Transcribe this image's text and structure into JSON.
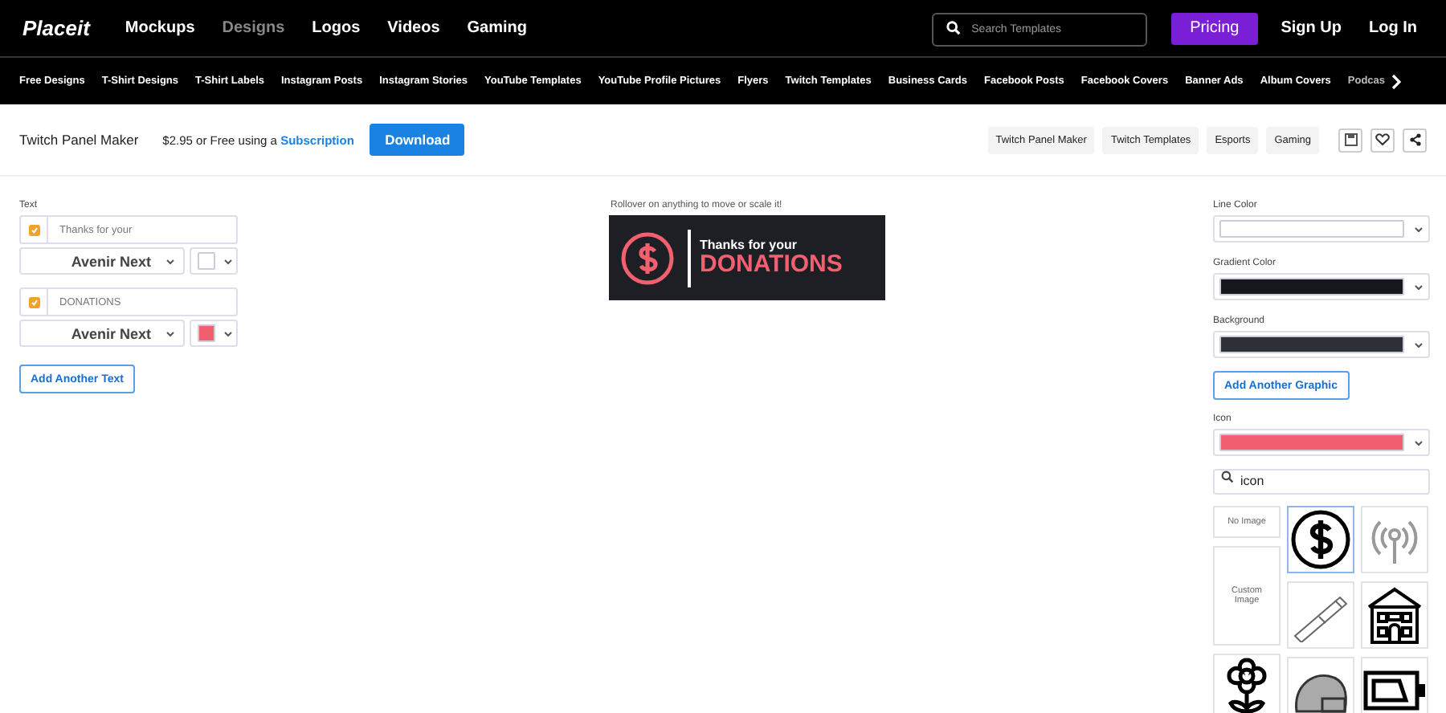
{
  "header": {
    "logo": "Placeit",
    "nav": [
      {
        "label": "Mockups",
        "selected": false
      },
      {
        "label": "Designs",
        "selected": true
      },
      {
        "label": "Logos",
        "selected": false
      },
      {
        "label": "Videos",
        "selected": false
      },
      {
        "label": "Gaming",
        "selected": false
      }
    ],
    "search": {
      "placeholder": "Search Templates"
    },
    "pricing": "Pricing",
    "sign_up": "Sign Up",
    "log_in": "Log In"
  },
  "categories": [
    "Free Designs",
    "T-Shirt Designs",
    "T-Shirt Labels",
    "Instagram Posts",
    "Instagram Stories",
    "YouTube Templates",
    "YouTube Profile Pictures",
    "Flyers",
    "Twitch Templates",
    "Business Cards",
    "Facebook Posts",
    "Facebook Covers",
    "Banner Ads",
    "Album Covers",
    "Podcas"
  ],
  "toolbar": {
    "title": "Twitch Panel Maker",
    "price": "$2.95 or Free using a",
    "link": "Subscription",
    "download": "Download",
    "tags": [
      "Twitch Panel Maker",
      "Twitch Templates",
      "Esports",
      "Gaming"
    ]
  },
  "text_panel": {
    "label": "Text",
    "items": [
      {
        "checked": true,
        "value": "Thanks for your",
        "font": "Avenir Next",
        "color": "#ffffff"
      },
      {
        "checked": true,
        "value": "DONATIONS",
        "font": "Avenir Next",
        "color": "#f0606e"
      }
    ],
    "add_button": "Add Another Text"
  },
  "preview": {
    "hint": "Rollover on anything to move or scale it!",
    "line_1": "Thanks for your",
    "line_2": "DONATIONS"
  },
  "graphic_panel": {
    "fields": [
      {
        "label": "Line Color",
        "color": "#ffffff"
      },
      {
        "label": "Gradient Color",
        "color": "#15171c"
      },
      {
        "label": "Background",
        "color": "#2e3038"
      }
    ],
    "add_button": "Add Another Graphic",
    "icon_field": {
      "label": "Icon",
      "color": "#f0606e"
    },
    "search": {
      "value": "icon"
    },
    "tile_columns": [
      [
        {
          "kind": "text",
          "label": "No Image",
          "selected": false
        },
        {
          "kind": "tall",
          "label": "Custom Image",
          "selected": false
        },
        {
          "kind": "icon",
          "selected": false
        }
      ],
      [
        {
          "kind": "icon",
          "selected": true
        },
        {
          "kind": "icon",
          "selected": false
        },
        {
          "kind": "icon",
          "selected": false
        }
      ],
      [
        {
          "kind": "icon",
          "selected": false
        },
        {
          "kind": "icon",
          "selected": false
        },
        {
          "kind": "icon",
          "selected": false
        }
      ]
    ]
  }
}
